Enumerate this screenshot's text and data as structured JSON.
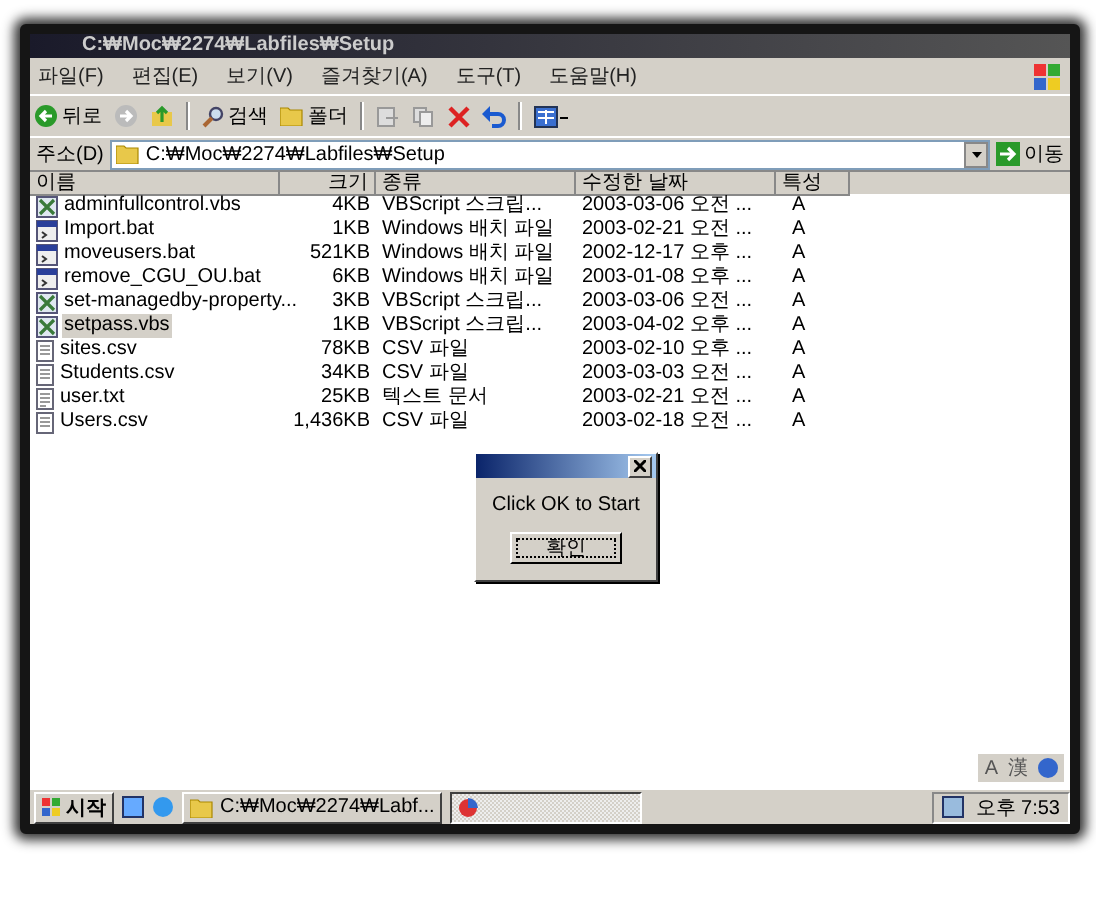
{
  "window": {
    "title": "C:₩Moc₩2274₩Labfiles₩Setup"
  },
  "menu": [
    "파일(F)",
    "편집(E)",
    "보기(V)",
    "즐겨찾기(A)",
    "도구(T)",
    "도움말(H)"
  ],
  "toolbar": [
    {
      "kind": "back",
      "label": "뒤로"
    },
    {
      "kind": "forward"
    },
    {
      "kind": "up"
    },
    {
      "kind": "search",
      "label": "검색"
    },
    {
      "kind": "folders",
      "label": "폴더"
    },
    {
      "kind": "move"
    },
    {
      "kind": "copy"
    },
    {
      "kind": "delete"
    },
    {
      "kind": "undo"
    },
    {
      "kind": "views"
    }
  ],
  "address": {
    "label": "주소(D)",
    "value": "C:₩Moc₩2274₩Labfiles₩Setup",
    "go": "이동"
  },
  "columns": [
    "이름",
    "크기",
    "종류",
    "수정한 날짜",
    "특성"
  ],
  "files": [
    {
      "kind": "vbs",
      "name": "adminfullcontrol.vbs",
      "size": "4KB",
      "type": "VBScript 스크립...",
      "date": "2003-03-06 오전 ...",
      "attr": "A",
      "selected": false
    },
    {
      "kind": "bat",
      "name": "Import.bat",
      "size": "1KB",
      "type": "Windows 배치 파일",
      "date": "2003-02-21 오전 ...",
      "attr": "A",
      "selected": false
    },
    {
      "kind": "bat",
      "name": "moveusers.bat",
      "size": "521KB",
      "type": "Windows 배치 파일",
      "date": "2002-12-17 오후 ...",
      "attr": "A",
      "selected": false
    },
    {
      "kind": "bat",
      "name": "remove_CGU_OU.bat",
      "size": "6KB",
      "type": "Windows 배치 파일",
      "date": "2003-01-08 오후 ...",
      "attr": "A",
      "selected": false
    },
    {
      "kind": "vbs",
      "name": "set-managedby-property...",
      "size": "3KB",
      "type": "VBScript 스크립...",
      "date": "2003-03-06 오전 ...",
      "attr": "A",
      "selected": false
    },
    {
      "kind": "vbs",
      "name": "setpass.vbs",
      "size": "1KB",
      "type": "VBScript 스크립...",
      "date": "2003-04-02 오후 ...",
      "attr": "A",
      "selected": true
    },
    {
      "kind": "csv",
      "name": "sites.csv",
      "size": "78KB",
      "type": "CSV 파일",
      "date": "2003-02-10 오후 ...",
      "attr": "A",
      "selected": false
    },
    {
      "kind": "csv",
      "name": "Students.csv",
      "size": "34KB",
      "type": "CSV 파일",
      "date": "2003-03-03 오전 ...",
      "attr": "A",
      "selected": false
    },
    {
      "kind": "txt",
      "name": "user.txt",
      "size": "25KB",
      "type": "텍스트 문서",
      "date": "2003-02-21 오전 ...",
      "attr": "A",
      "selected": false
    },
    {
      "kind": "csv",
      "name": "Users.csv",
      "size": "1,436KB",
      "type": "CSV 파일",
      "date": "2003-02-18 오전 ...",
      "attr": "A",
      "selected": false
    }
  ],
  "dialog": {
    "message": "Click OK to Start",
    "button": "확인"
  },
  "language_bar": [
    "A",
    "漢"
  ],
  "taskbar": {
    "start": "시작",
    "tasks": [
      {
        "kind": "folder",
        "label": "C:₩Moc₩2274₩Labf..."
      },
      {
        "kind": "app"
      }
    ],
    "clock": "오후 7:53"
  }
}
